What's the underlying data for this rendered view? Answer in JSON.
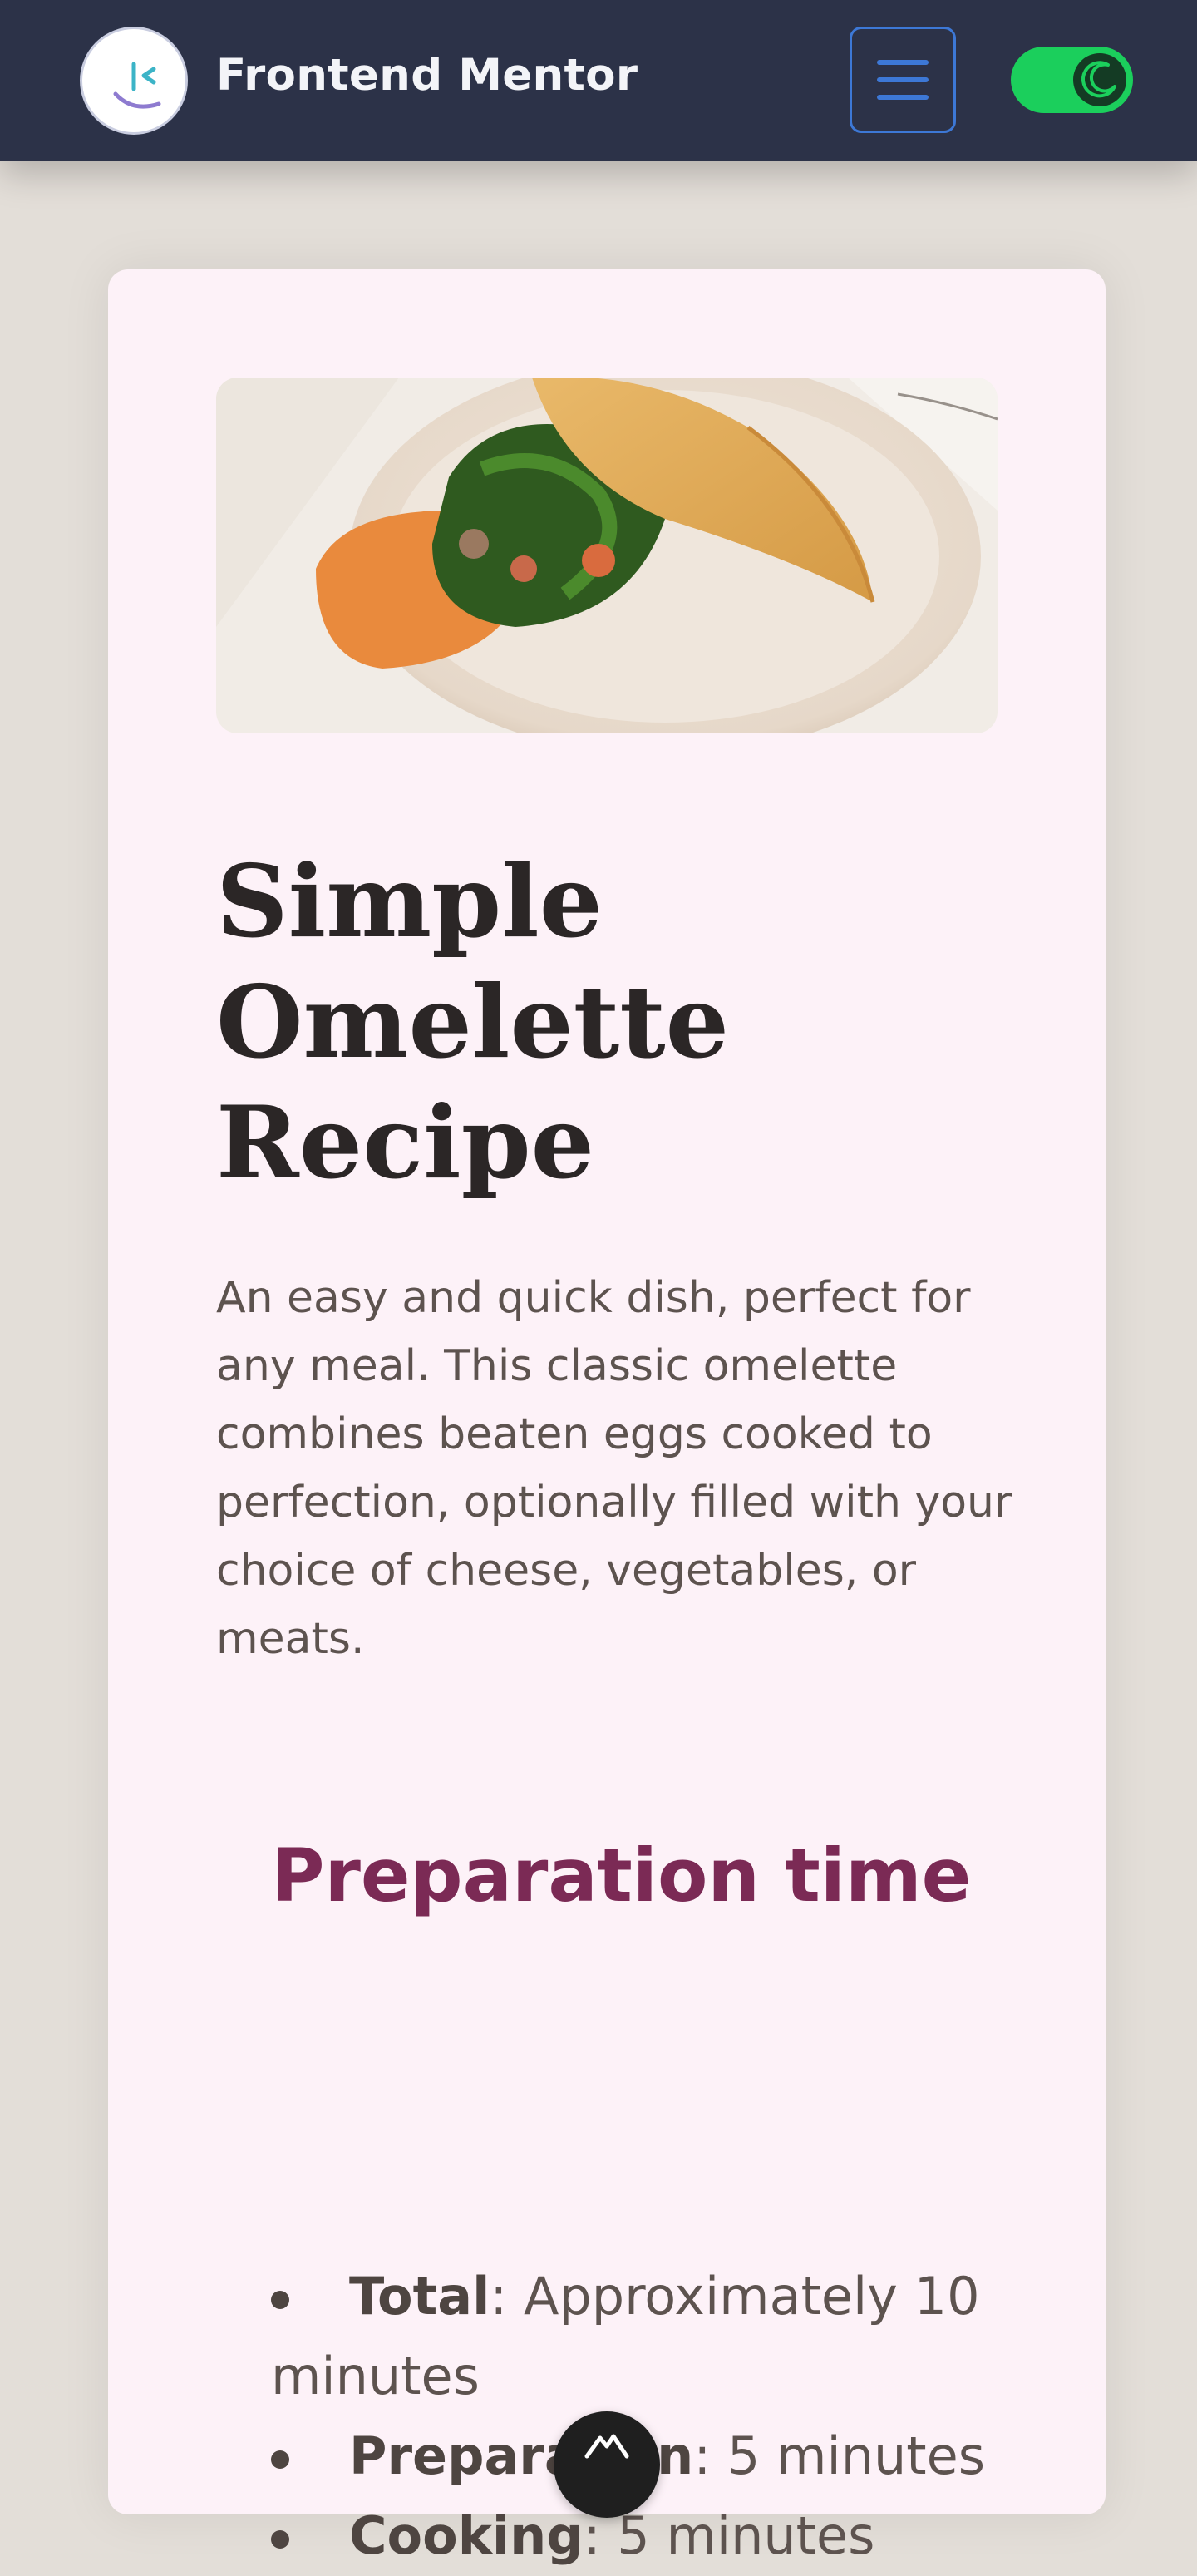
{
  "header": {
    "brand": "Frontend Mentor",
    "logo_icon": "frontend-mentor-logo-icon",
    "menu_icon": "hamburger-menu-icon",
    "theme_toggle_icon": "moon-icon",
    "theme_toggle_on": true,
    "colors": {
      "background": "#2c3248",
      "menu_accent": "#3d78d6",
      "toggle": "#1bcf5c"
    }
  },
  "recipe": {
    "image_alt_icon": "omelette-photo",
    "title": "Simple Omelette Recipe",
    "description": "An easy and quick dish, perfect for any meal. This classic omelette combines beaten eggs cooked to perfection, optionally filled with your choice of cheese, vegetables, or meats.",
    "preparation": {
      "heading": "Preparation time",
      "items": [
        {
          "label": "Total",
          "value": ": Approximately 10 minutes"
        },
        {
          "label": "Preparation",
          "value": ": 5 minutes"
        },
        {
          "label": "Cooking",
          "value": ": 5 minutes"
        }
      ]
    },
    "colors": {
      "card": "#fdf2f8",
      "heading": "#7b2a55",
      "text": "#5d534f"
    }
  },
  "floating_badge_icon": "mountain-logo-icon"
}
